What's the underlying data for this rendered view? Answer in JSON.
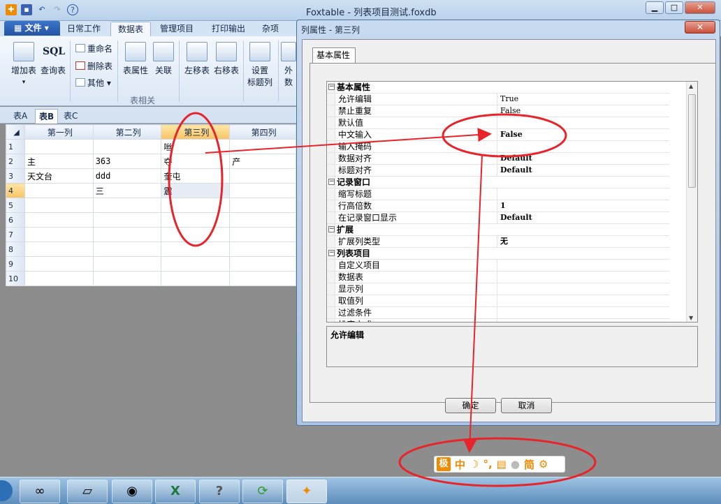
{
  "window": {
    "title": "Foxtable - 列表项目测试.foxdb",
    "buttons": {
      "min": "▁",
      "max": "□",
      "close": "✕"
    }
  },
  "ribbon": {
    "file_tab": "文件",
    "tabs": [
      "日常工作",
      "数据表",
      "管理项目",
      "打印输出",
      "杂项"
    ],
    "buttons": {
      "add_table": "增加表",
      "query_table": "查询表",
      "rename": "重命名",
      "delete_table": "删除表",
      "other": "其他",
      "table_props": "表属性",
      "relation": "关联",
      "move_left": "左移表",
      "move_right": "右移表",
      "set_title_col": "设置",
      "set_title_col_2": "标题列",
      "ext_1": "外",
      "ext_2": "数"
    },
    "group_label": "表相关",
    "sql_text": "SQL"
  },
  "sheet_tabs": [
    "表A",
    "表B",
    "表C"
  ],
  "grid": {
    "columns": [
      "第一列",
      "第二列",
      "第三列",
      "第四列"
    ],
    "rows": [
      [
        "1",
        "",
        "",
        "咝",
        ""
      ],
      [
        "2",
        "主",
        "363",
        "夺",
        "产"
      ],
      [
        "3",
        "天文台",
        "ddd",
        "奎屯",
        ""
      ],
      [
        "4",
        "",
        "三",
        "震",
        ""
      ],
      [
        "5",
        "",
        "",
        "",
        ""
      ],
      [
        "6",
        "",
        "",
        "",
        ""
      ],
      [
        "7",
        "",
        "",
        "",
        ""
      ],
      [
        "8",
        "",
        "",
        "",
        ""
      ],
      [
        "9",
        "",
        "",
        "",
        ""
      ],
      [
        "10",
        "",
        "",
        "",
        ""
      ]
    ]
  },
  "dialog": {
    "title": "列属性 - 第三列",
    "tab": "基本属性",
    "properties": [
      {
        "type": "cat",
        "name": "基本属性",
        "toggle": "⊟"
      },
      {
        "name": "允许编辑",
        "value": "True"
      },
      {
        "name": "禁止重复",
        "value": "False"
      },
      {
        "name": "默认值",
        "value": ""
      },
      {
        "name": "中文输入",
        "value": "False",
        "bold": true
      },
      {
        "name": "输入掩码",
        "value": ""
      },
      {
        "name": "数据对齐",
        "value": "Default",
        "bold": true
      },
      {
        "name": "标题对齐",
        "value": "Default",
        "bold": true
      },
      {
        "type": "cat",
        "name": "记录窗口",
        "toggle": "⊟"
      },
      {
        "name": "缩写标题",
        "value": ""
      },
      {
        "name": "行高倍数",
        "value": "1",
        "bold": true
      },
      {
        "name": "在记录窗口显示",
        "value": "Default",
        "bold": true
      },
      {
        "type": "cat",
        "name": "扩展",
        "toggle": "⊟"
      },
      {
        "name": "扩展列类型",
        "value": "无",
        "bold": true
      },
      {
        "type": "cat",
        "name": "列表项目",
        "toggle": "⊟"
      },
      {
        "name": "自定义项目",
        "value": ""
      },
      {
        "name": "数据表",
        "value": ""
      },
      {
        "name": "显示列",
        "value": ""
      },
      {
        "name": "取值列",
        "value": ""
      },
      {
        "name": "过滤条件",
        "value": ""
      },
      {
        "name": "排序方式",
        "value": ""
      }
    ],
    "description": "允许编辑",
    "ok": "确定",
    "cancel": "取消"
  },
  "ime": {
    "logo": "极",
    "mode": "中",
    "width": "简"
  },
  "colors": {
    "accent": "#f08a00",
    "annotation": "#e8242b"
  }
}
